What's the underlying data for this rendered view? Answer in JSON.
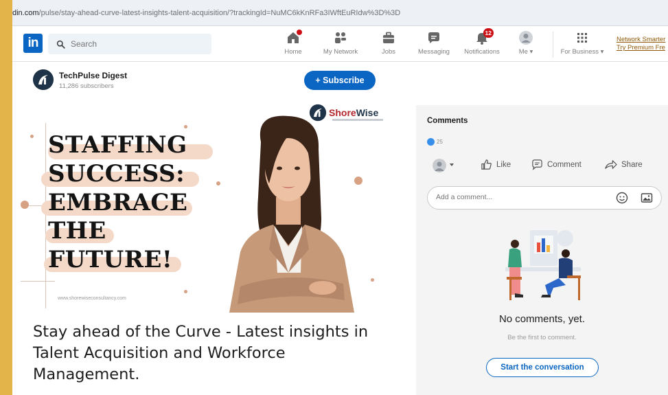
{
  "browser": {
    "url_host": "din.com",
    "url_path": "/pulse/stay-ahead-curve-latest-insights-talent-acquisition/?trackingId=NuMC6kKnRFa3IWftEuRIdw%3D%3D"
  },
  "nav": {
    "logo": "in",
    "search_placeholder": "Search",
    "items": [
      {
        "label": "Home",
        "icon": "home-icon",
        "badge": ""
      },
      {
        "label": "My Network",
        "icon": "network-icon",
        "badge": ""
      },
      {
        "label": "Jobs",
        "icon": "briefcase-icon",
        "badge": ""
      },
      {
        "label": "Messaging",
        "icon": "message-icon",
        "badge": ""
      },
      {
        "label": "Notifications",
        "icon": "bell-icon",
        "badge": "12"
      },
      {
        "label": "Me ▾",
        "icon": "avatar-icon",
        "badge": ""
      },
      {
        "label": "For Business ▾",
        "icon": "grid-icon",
        "badge": ""
      }
    ],
    "premium_line1": "Network Smarter",
    "premium_line2": "Try Premium Fre"
  },
  "publisher": {
    "name": "TechPulse Digest",
    "subscribers": "11,286 subscribers",
    "subscribe_label": "+ Subscribe"
  },
  "cover": {
    "brand_part1": "Shore",
    "brand_part2": "Wise",
    "headline_lines": [
      "STAFFING",
      "SUCCESS:",
      "EMBRACE",
      "THE",
      "FUTURE!"
    ],
    "footer_url": "www.shorewiseconsultancy.com"
  },
  "article": {
    "title": "Stay ahead of the Curve - Latest insights in Talent Acquisition and Workforce Management."
  },
  "comments": {
    "title": "Comments",
    "reaction_count": "25",
    "actions": {
      "like": "Like",
      "comment": "Comment",
      "share": "Share"
    },
    "input_placeholder": "Add a comment...",
    "empty_title": "No comments, yet.",
    "empty_sub": "Be the first to comment.",
    "start_button": "Start the conversation"
  },
  "colors": {
    "linkedin_blue": "#0a66c2",
    "notification_red": "#cc1016",
    "cover_accent": "#f4d8c8",
    "side_strip": "#e2b44a"
  }
}
